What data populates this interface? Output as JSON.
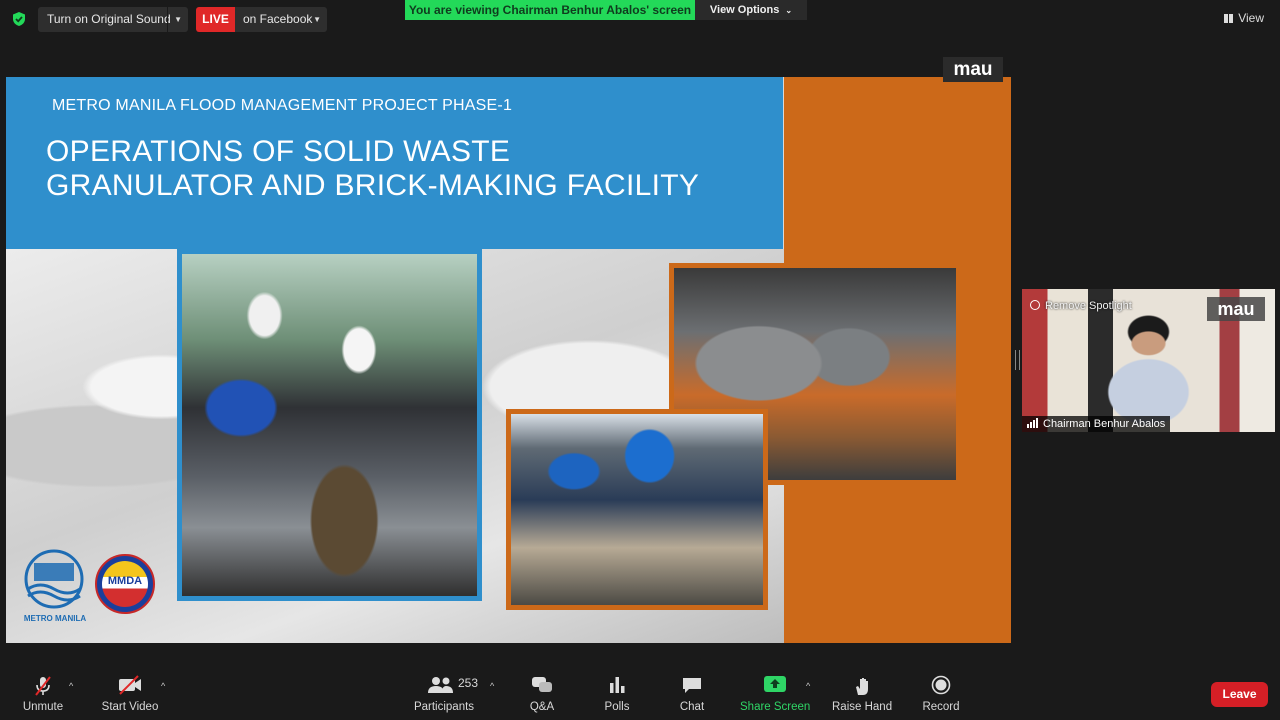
{
  "top_bar": {
    "original_sound_label": "Turn on Original Sound",
    "live_badge": "LIVE",
    "live_destination": "on Facebook",
    "viewing_banner": "You are viewing Chairman Benhur Abalos' screen",
    "view_options_label": "View Options",
    "view_label": "View",
    "shield_color": "#23d959"
  },
  "slide": {
    "subtitle": "METRO MANILA FLOOD MANAGEMENT PROJECT PHASE-1",
    "title_line1": "OPERATIONS OF SOLID WASTE",
    "title_line2": "GRANULATOR AND BRICK-MAKING FACILITY",
    "watermark": "mau",
    "logo_left_text": "METRO MANILA",
    "logo_right_text": "MMDA",
    "colors": {
      "title_blue": "#2f8fcc",
      "accent_orange": "#cc6919"
    }
  },
  "participant_video": {
    "remove_spotlight_label": "Remove Spotlight",
    "watermark": "mau",
    "name": "Chairman Benhur Abalos"
  },
  "toolbar": {
    "unmute_label": "Unmute",
    "start_video_label": "Start Video",
    "participants_label": "Participants",
    "participants_count": "253",
    "qa_label": "Q&A",
    "polls_label": "Polls",
    "chat_label": "Chat",
    "share_screen_label": "Share Screen",
    "raise_hand_label": "Raise Hand",
    "record_label": "Record",
    "leave_label": "Leave",
    "share_color": "#2fd566",
    "leave_color": "#d51f26"
  }
}
